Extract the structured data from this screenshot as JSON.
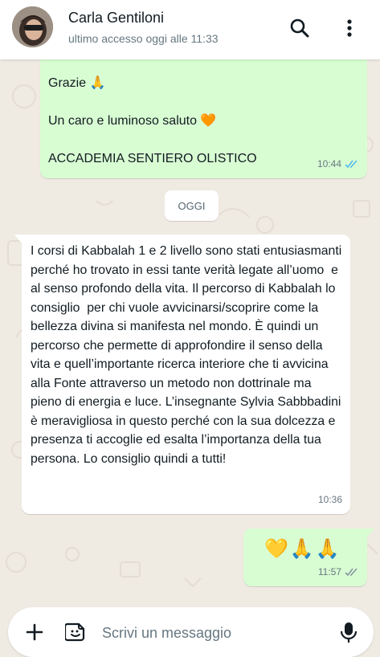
{
  "contact": {
    "name": "Carla Gentiloni",
    "status": "ultimo accesso oggi alle 11:33"
  },
  "messages": [
    {
      "direction": "outgoing",
      "text": "Grazie 🙏\n\nUn caro e luminoso saluto 🧡\n\nACCADEMIA SENTIERO OLISTICO",
      "time": "10:44",
      "status": "read"
    },
    {
      "direction": "incoming",
      "text": "I corsi di Kabbalah 1 e 2 livello sono stati entusiasmanti perché ho trovato in essi tante verità legate all’uomo  e al senso profondo della vita. Il percorso di Kabbalah lo consiglio  per chi vuole avvicinarsi/scoprire come la bellezza divina si manifesta nel mondo. È quindi un percorso che permette di approfondire il senso della vita e quell’importante ricerca interiore che ti avvicina alla Fonte attraverso un metodo non dottrinale ma pieno di energia e luce. L’insegnante Sylvia Sabbbadini è meravigliosa in questo perché con la sua dolcezza e presenza ti accoglie ed esalta l’importanza della tua persona. Lo consiglio quindi a tutti!",
      "time": "10:36"
    },
    {
      "direction": "outgoing",
      "text": "💛🙏🙏",
      "time": "11:57",
      "status": "delivered"
    }
  ],
  "date_chip": "OGGI",
  "composer": {
    "placeholder": "Scrivi un messaggio"
  },
  "colors": {
    "outgoing_bubble": "#d9fdd3",
    "incoming_bubble": "#ffffff",
    "read_ticks": "#53bdeb",
    "background": "#efeae2"
  }
}
